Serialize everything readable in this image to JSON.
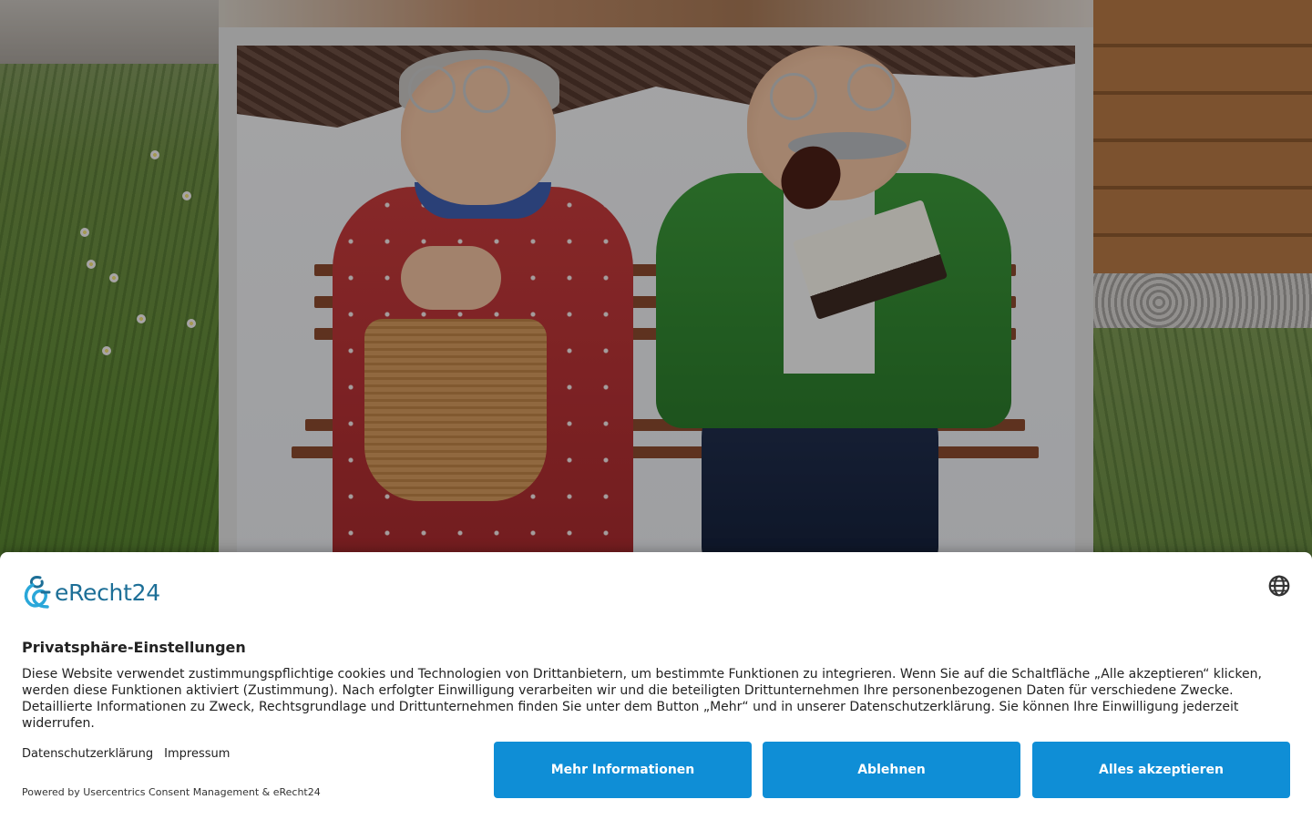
{
  "banner": {
    "brand": "eRecht24",
    "title": "Privatsphäre-Einstellungen",
    "description": "Diese Website verwendet zustimmungspflichtige cookies und Technologien von Drittanbietern, um bestimmte Funktionen zu integrieren. Wenn Sie auf die Schaltfläche „Alle akzeptieren“ klicken, werden diese Funktionen aktiviert (Zustimmung). Nach erfolgter Einwilligung verarbeiten wir und die beteiligten Drittunternehmen Ihre personenbezogenen Daten für verschiedene Zwecke. Detaillierte Informationen zu Zweck, Rechtsgrundlage und Drittunternehmen finden Sie unter dem Button „Mehr“ und in unserer Datenschutzerklärung. Sie können Ihre Einwilligung jederzeit widerrufen.",
    "links": {
      "privacy": "Datenschutzerklärung",
      "imprint": "Impressum"
    },
    "powered_by": "Powered by Usercentrics Consent Management & eRecht24",
    "buttons": {
      "more": "Mehr Informationen",
      "deny": "Ablehnen",
      "accept": "Alles akzeptieren"
    },
    "language_icon": "globe-icon"
  },
  "colors": {
    "accent": "#0f8ed6",
    "brand": "#1d6f97",
    "overlay": "rgba(0,0,0,0.32)"
  }
}
